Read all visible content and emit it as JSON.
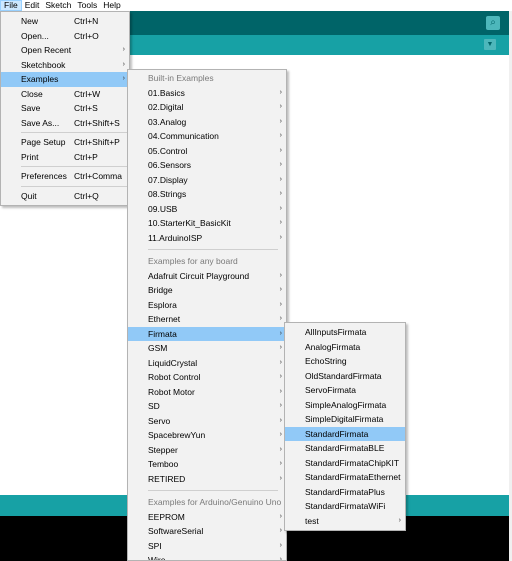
{
  "menubar": [
    "File",
    "Edit",
    "Sketch",
    "Tools",
    "Help"
  ],
  "file_menu": [
    {
      "label": "New",
      "shortcut": "Ctrl+N"
    },
    {
      "label": "Open...",
      "shortcut": "Ctrl+O"
    },
    {
      "label": "Open Recent",
      "submenu": true
    },
    {
      "label": "Sketchbook",
      "submenu": true
    },
    {
      "label": "Examples",
      "submenu": true,
      "highlighted": true
    },
    {
      "label": "Close",
      "shortcut": "Ctrl+W"
    },
    {
      "label": "Save",
      "shortcut": "Ctrl+S"
    },
    {
      "label": "Save As...",
      "shortcut": "Ctrl+Shift+S"
    },
    {
      "separator": true
    },
    {
      "label": "Page Setup",
      "shortcut": "Ctrl+Shift+P"
    },
    {
      "label": "Print",
      "shortcut": "Ctrl+P"
    },
    {
      "separator": true
    },
    {
      "label": "Preferences",
      "shortcut": "Ctrl+Comma"
    },
    {
      "separator": true
    },
    {
      "label": "Quit",
      "shortcut": "Ctrl+Q"
    }
  ],
  "examples_menu": [
    {
      "header": "Built-in Examples"
    },
    {
      "label": "01.Basics",
      "submenu": true
    },
    {
      "label": "02.Digital",
      "submenu": true
    },
    {
      "label": "03.Analog",
      "submenu": true
    },
    {
      "label": "04.Communication",
      "submenu": true
    },
    {
      "label": "05.Control",
      "submenu": true
    },
    {
      "label": "06.Sensors",
      "submenu": true
    },
    {
      "label": "07.Display",
      "submenu": true
    },
    {
      "label": "08.Strings",
      "submenu": true
    },
    {
      "label": "09.USB",
      "submenu": true
    },
    {
      "label": "10.StarterKit_BasicKit",
      "submenu": true
    },
    {
      "label": "11.ArduinoISP",
      "submenu": true
    },
    {
      "separator": true
    },
    {
      "header": "Examples for any board"
    },
    {
      "label": "Adafruit Circuit Playground",
      "submenu": true
    },
    {
      "label": "Bridge",
      "submenu": true
    },
    {
      "label": "Esplora",
      "submenu": true
    },
    {
      "label": "Ethernet",
      "submenu": true
    },
    {
      "label": "Firmata",
      "submenu": true,
      "highlighted": true
    },
    {
      "label": "GSM",
      "submenu": true
    },
    {
      "label": "LiquidCrystal",
      "submenu": true
    },
    {
      "label": "Robot Control",
      "submenu": true
    },
    {
      "label": "Robot Motor",
      "submenu": true
    },
    {
      "label": "SD",
      "submenu": true
    },
    {
      "label": "Servo",
      "submenu": true
    },
    {
      "label": "SpacebrewYun",
      "submenu": true
    },
    {
      "label": "Stepper",
      "submenu": true
    },
    {
      "label": "Temboo",
      "submenu": true
    },
    {
      "label": "RETIRED",
      "submenu": true
    },
    {
      "separator": true
    },
    {
      "header": "Examples for Arduino/Genuino Uno"
    },
    {
      "label": "EEPROM",
      "submenu": true
    },
    {
      "label": "SoftwareSerial",
      "submenu": true
    },
    {
      "label": "SPI",
      "submenu": true
    },
    {
      "label": "Wire",
      "submenu": true
    }
  ],
  "firmata_menu": [
    {
      "label": "AllInputsFirmata"
    },
    {
      "label": "AnalogFirmata"
    },
    {
      "label": "EchoString"
    },
    {
      "label": "OldStandardFirmata"
    },
    {
      "label": "ServoFirmata"
    },
    {
      "label": "SimpleAnalogFirmata"
    },
    {
      "label": "SimpleDigitalFirmata"
    },
    {
      "label": "StandardFirmata",
      "highlighted": true
    },
    {
      "label": "StandardFirmataBLE"
    },
    {
      "label": "StandardFirmataChipKIT"
    },
    {
      "label": "StandardFirmataEthernet"
    },
    {
      "label": "StandardFirmataPlus"
    },
    {
      "label": "StandardFirmataWiFi"
    },
    {
      "label": "test",
      "submenu": true
    }
  ],
  "icons": {
    "serial_monitor": "magnifier-icon",
    "tab_menu": "dropdown-arrow-icon",
    "submenu_arrow": "›"
  },
  "colors": {
    "toolbar": "#006468",
    "tabbar": "#17a1a5",
    "console": "#000000",
    "menu_bg": "#f2f2f2",
    "highlight": "#91c9f7"
  }
}
